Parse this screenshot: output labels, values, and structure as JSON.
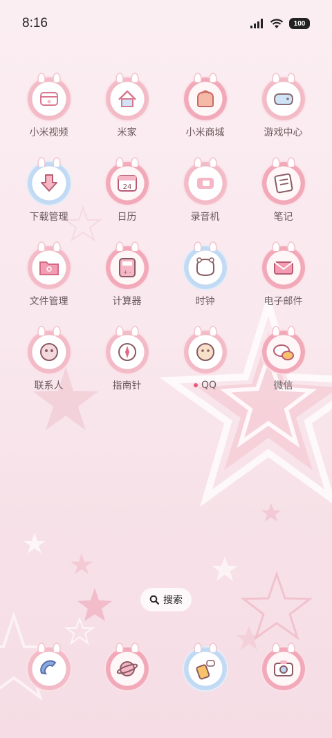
{
  "status_bar": {
    "time": "8:16",
    "battery": "100"
  },
  "apps": [
    {
      "label": "小米视频",
      "icon": "video-icon",
      "theme": "pink"
    },
    {
      "label": "米家",
      "icon": "home-icon",
      "theme": "pink"
    },
    {
      "label": "小米商城",
      "icon": "shopping-bag-icon",
      "theme": "solid"
    },
    {
      "label": "游戏中心",
      "icon": "game-controller-icon",
      "theme": "pink"
    },
    {
      "label": "下载管理",
      "icon": "download-icon",
      "theme": "blue"
    },
    {
      "label": "日历",
      "icon": "calendar-icon",
      "theme": "solid",
      "calendar_day": "24"
    },
    {
      "label": "录音机",
      "icon": "recorder-icon",
      "theme": "pink"
    },
    {
      "label": "笔记",
      "icon": "notes-icon",
      "theme": "solid"
    },
    {
      "label": "文件管理",
      "icon": "folder-icon",
      "theme": "pink"
    },
    {
      "label": "计算器",
      "icon": "calculator-icon",
      "theme": "solid"
    },
    {
      "label": "时钟",
      "icon": "clock-icon",
      "theme": "blue"
    },
    {
      "label": "电子邮件",
      "icon": "mail-icon",
      "theme": "solid"
    },
    {
      "label": "联系人",
      "icon": "contacts-icon",
      "theme": "pink"
    },
    {
      "label": "指南针",
      "icon": "compass-icon",
      "theme": "pink"
    },
    {
      "label": "QQ",
      "icon": "qq-icon",
      "theme": "pink",
      "has_notification": true
    },
    {
      "label": "微信",
      "icon": "wechat-icon",
      "theme": "solid"
    }
  ],
  "search": {
    "label": "搜索"
  },
  "dock": [
    {
      "icon": "phone-icon",
      "theme": "pink"
    },
    {
      "icon": "browser-icon",
      "theme": "solid"
    },
    {
      "icon": "messages-icon",
      "theme": "blue"
    },
    {
      "icon": "camera-icon",
      "theme": "solid"
    }
  ],
  "colors": {
    "accent_pink": "#f1a7b7",
    "accent_blue": "#bfd8f3",
    "notification": "#e8587a",
    "label_text": "#6b5a5e"
  }
}
